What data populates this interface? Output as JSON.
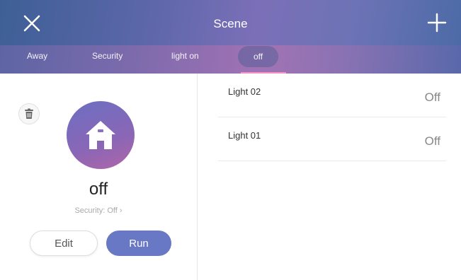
{
  "header": {
    "title": "Scene",
    "tabs": [
      {
        "label": "Away",
        "active": false
      },
      {
        "label": "Security",
        "active": false
      },
      {
        "label": "light on",
        "active": false
      },
      {
        "label": "off",
        "active": true
      }
    ]
  },
  "scene": {
    "name": "off",
    "security_label": "Security: Off ›",
    "icon": "home-icon"
  },
  "actions": {
    "edit_label": "Edit",
    "run_label": "Run"
  },
  "devices": [
    {
      "name": "Light 02",
      "state": "Off"
    },
    {
      "name": "Light 01",
      "state": "Off"
    }
  ],
  "colors": {
    "accent": "#6878c4",
    "header_start": "#3e5f96",
    "header_mid": "#7b6fb8"
  }
}
